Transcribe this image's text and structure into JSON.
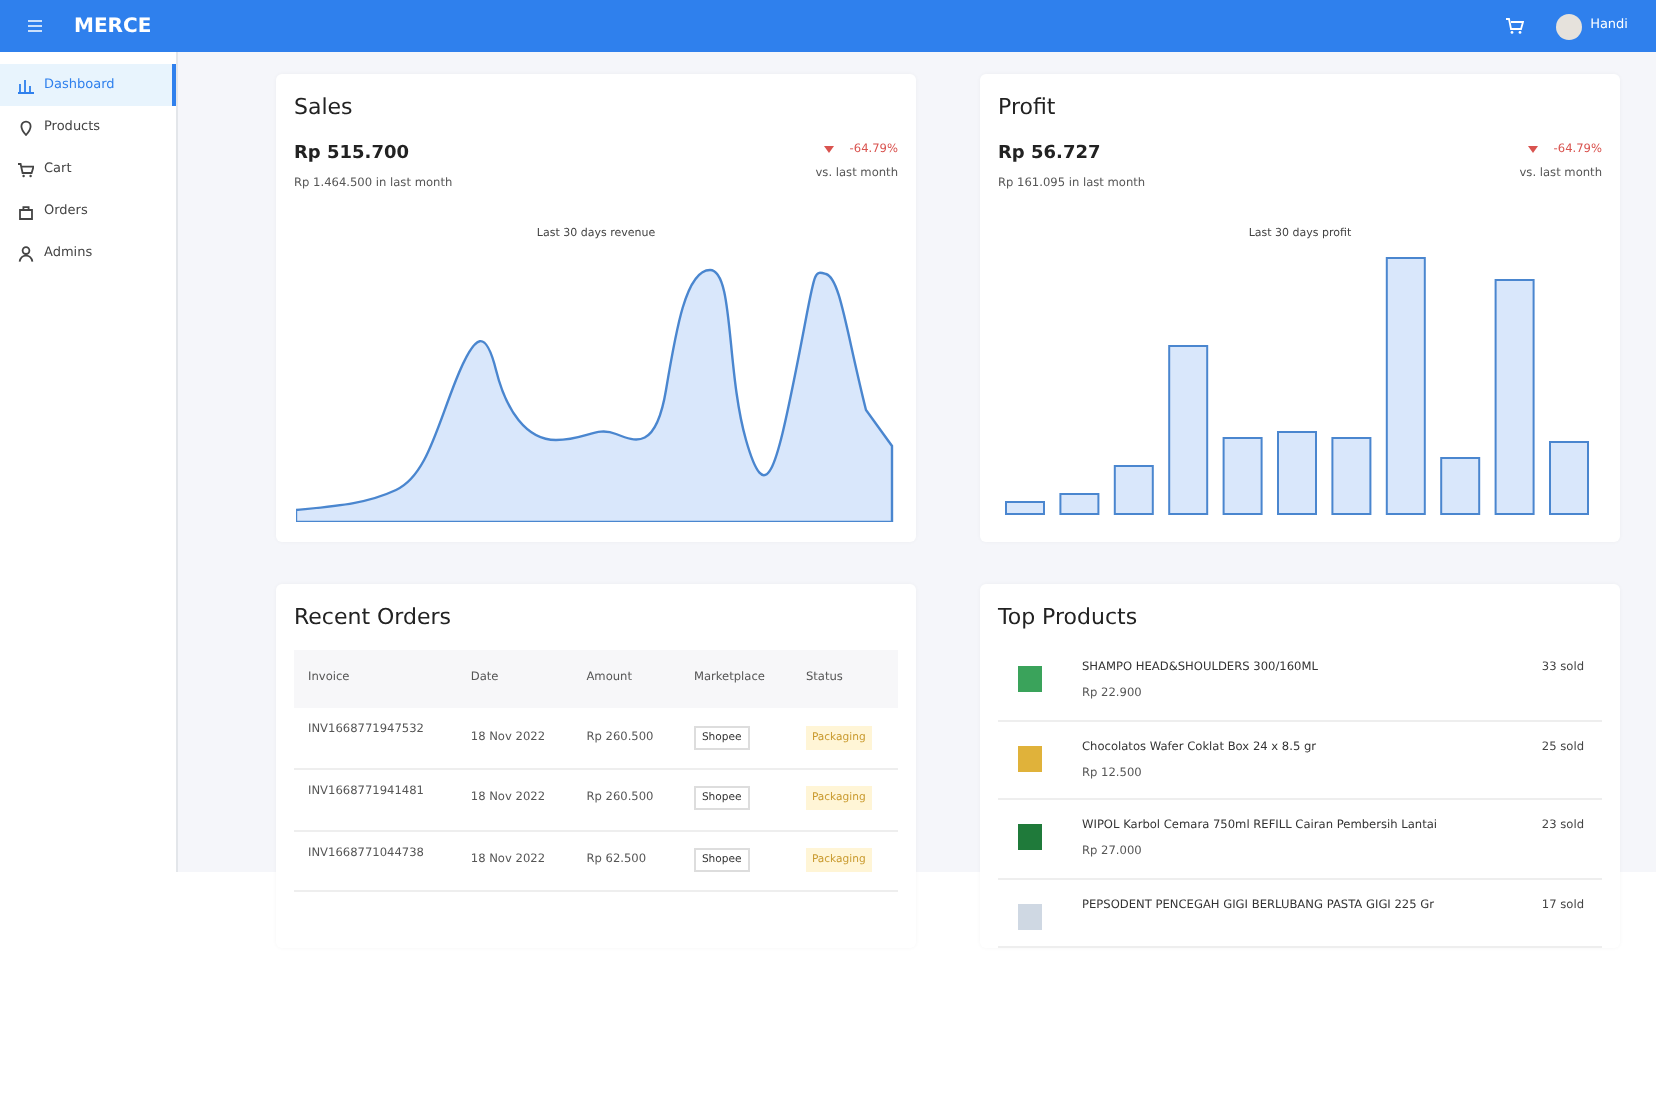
{
  "navbar": {
    "brand": "MERCE",
    "user": "Handi"
  },
  "sidebar": {
    "items": [
      {
        "label": "Dashboard",
        "selected": true
      },
      {
        "label": "Products",
        "selected": false
      },
      {
        "label": "Cart",
        "selected": false
      },
      {
        "label": "Orders",
        "selected": false
      },
      {
        "label": "Admins",
        "selected": false
      }
    ]
  },
  "sales": {
    "title": "Sales",
    "value": "Rp 515.700",
    "previous": "Rp 1.464.500 in last month",
    "change": "-64.79%",
    "compare": "vs. last month",
    "chart_title": "Last 30 days revenue"
  },
  "profit": {
    "title": "Profit",
    "value": "Rp 56.727",
    "previous": "Rp 161.095 in last month",
    "change": "-64.79%",
    "compare": "vs. last month",
    "chart_title": "Last 30 days profit"
  },
  "recent_orders": {
    "title": "Recent Orders",
    "columns": [
      "Invoice",
      "Date",
      "Amount",
      "Marketplace",
      "Status"
    ],
    "rows": [
      {
        "invoice": "INV1668771947532",
        "date": "18 Nov 2022",
        "amount": "Rp 260.500",
        "marketplace": "Shopee",
        "status": "Packaging"
      },
      {
        "invoice": "INV1668771941481",
        "date": "18 Nov 2022",
        "amount": "Rp 260.500",
        "marketplace": "Shopee",
        "status": "Packaging"
      },
      {
        "invoice": "INV1668771044738",
        "date": "18 Nov 2022",
        "amount": "Rp 62.500",
        "marketplace": "Shopee",
        "status": "Packaging"
      }
    ]
  },
  "top_products": {
    "title": "Top Products",
    "items": [
      {
        "name": "SHAMPO HEAD&SHOULDERS 300/160ML",
        "price": "Rp 22.900",
        "sold": "33 sold"
      },
      {
        "name": "Chocolatos Wafer Coklat Box 24 x 8.5 gr",
        "price": "Rp 12.500",
        "sold": "25 sold"
      },
      {
        "name": "WIPOL Karbol Cemara 750ml REFILL Cairan Pembersih Lantai",
        "price": "Rp 27.000",
        "sold": "23 sold"
      },
      {
        "name": "PEPSODENT PENCEGAH GIGI BERLUBANG PASTA GIGI 225 Gr",
        "sold": "17 sold"
      }
    ]
  }
}
